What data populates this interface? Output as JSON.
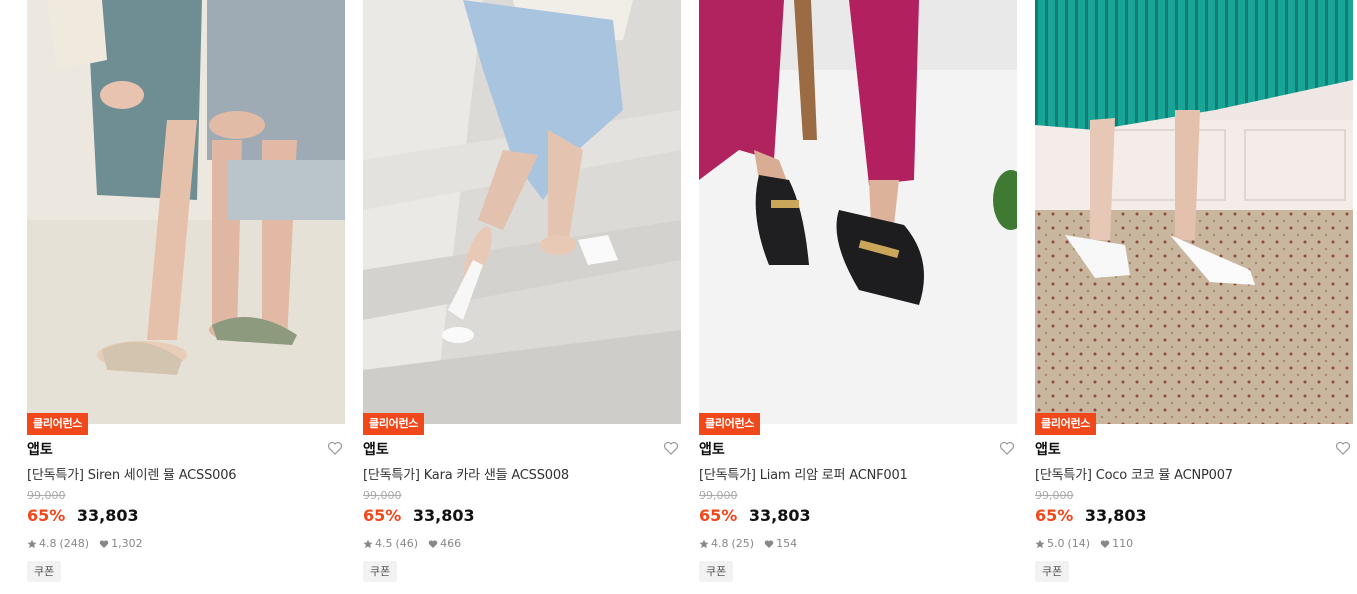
{
  "products": [
    {
      "badge": "클리어런스",
      "brand": "앱토",
      "name": "[단독특가] Siren 세이렌 뮬 ACSS006",
      "original_price": "99,000",
      "discount": "65%",
      "price": "33,803",
      "rating": "4.8",
      "reviews": "(248)",
      "likes": "1,302",
      "coupon": "쿠폰"
    },
    {
      "badge": "클리어런스",
      "brand": "앱토",
      "name": "[단독특가] Kara 카라 샌들 ACSS008",
      "original_price": "99,000",
      "discount": "65%",
      "price": "33,803",
      "rating": "4.5",
      "reviews": "(46)",
      "likes": "466",
      "coupon": "쿠폰"
    },
    {
      "badge": "클리어런스",
      "brand": "앱토",
      "name": "[단독특가] Liam 리암 로퍼 ACNF001",
      "original_price": "99,000",
      "discount": "65%",
      "price": "33,803",
      "rating": "4.8",
      "reviews": "(25)",
      "likes": "154",
      "coupon": "쿠폰"
    },
    {
      "badge": "클리어런스",
      "brand": "앱토",
      "name": "[단독특가] Coco 코코 뮬 ACNP007",
      "original_price": "99,000",
      "discount": "65%",
      "price": "33,803",
      "rating": "5.0",
      "reviews": "(14)",
      "likes": "110",
      "coupon": "쿠폰"
    }
  ],
  "colors": {
    "badge": "#f0471b",
    "discount": "#f0471b",
    "coupon_bg": "#f2f2f2"
  },
  "icons": [
    "heart-outline-icon",
    "star-icon",
    "heart-filled-icon"
  ]
}
